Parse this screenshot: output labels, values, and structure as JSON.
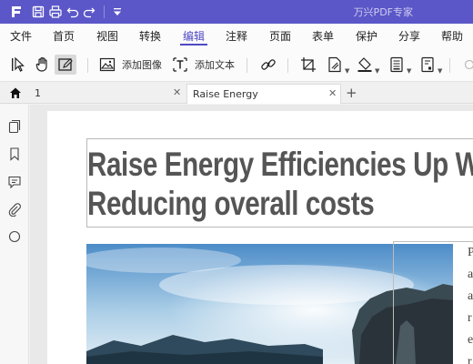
{
  "app": {
    "title": "万兴PDF专家"
  },
  "menu": {
    "items": [
      "文件",
      "首页",
      "视图",
      "转换",
      "编辑",
      "注释",
      "页面",
      "表单",
      "保护",
      "分享",
      "帮助"
    ],
    "active": "编辑"
  },
  "toolbar": {
    "add_image_label": "添加图像",
    "add_text_label": "添加文本"
  },
  "tabs": [
    {
      "label": "1"
    },
    {
      "label": "Raise Energy"
    }
  ],
  "document": {
    "headline_line1": "Raise Energy Efficiencies Up W",
    "headline_line2": "Reducing overall costs",
    "side_column_letters": [
      "P",
      "a",
      "a",
      "r",
      "e",
      "r"
    ]
  },
  "colors": {
    "titlebar": "#5b57c8",
    "accent": "#4f49c4",
    "headline": "#555555"
  }
}
